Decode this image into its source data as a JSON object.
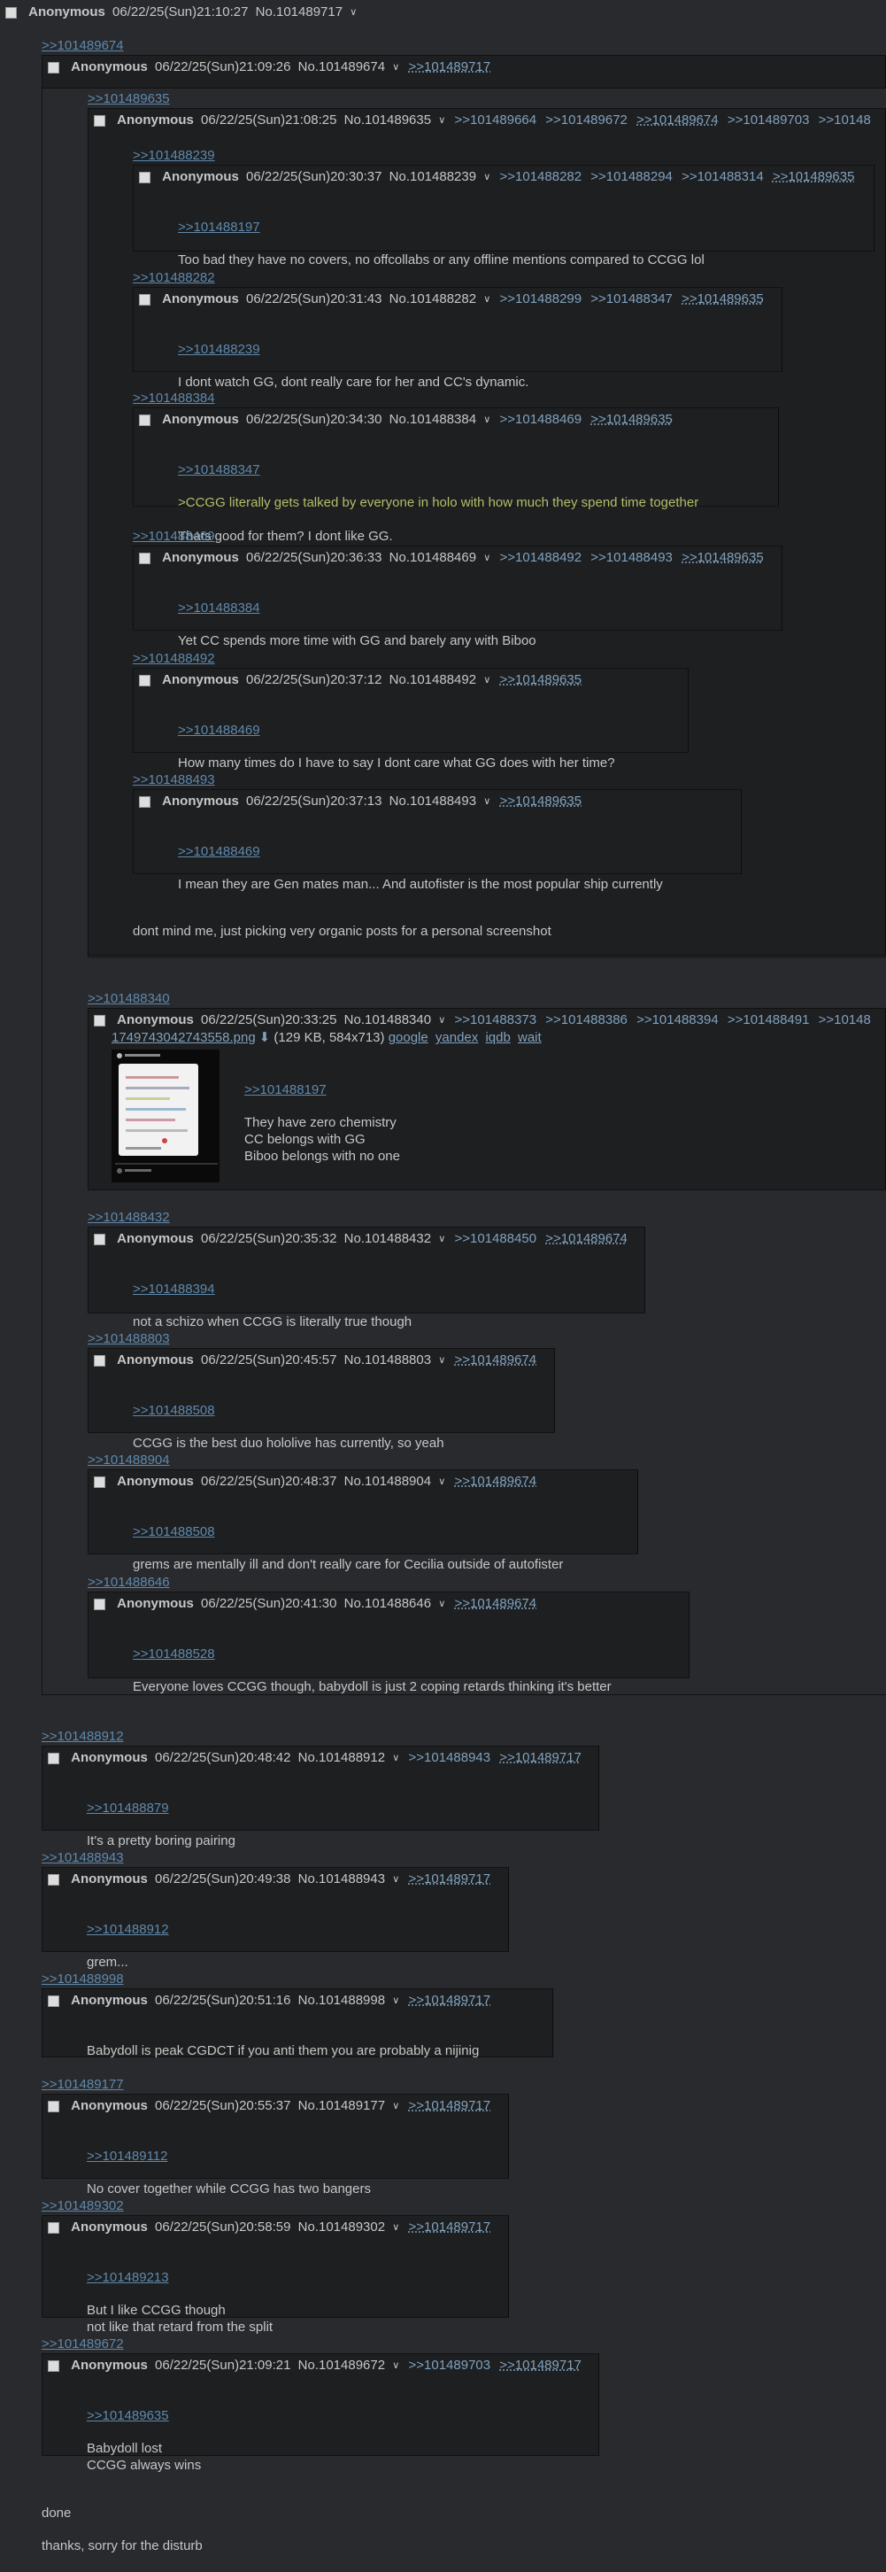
{
  "op": {
    "name": "Anonymous",
    "datetime": "06/22/25(Sun)21:10:27",
    "number": "No.101489717"
  },
  "posts": [
    {
      "id": "p1",
      "quote_header": ">>101489674",
      "name": "Anonymous",
      "datetime": "06/22/25(Sun)21:09:26",
      "number": "No.101489674",
      "backlinks": [
        ">>101489717"
      ]
    },
    {
      "id": "p2",
      "quote_header": ">>101489635",
      "name": "Anonymous",
      "datetime": "06/22/25(Sun)21:08:25",
      "number": "No.101489635",
      "backlinks": [
        ">>101489664",
        ">>101489672",
        ">>101489674",
        ">>101489703",
        ">>10148"
      ]
    },
    {
      "id": "p3",
      "quote_header": ">>101488239",
      "name": "Anonymous",
      "datetime": "06/22/25(Sun)20:30:37",
      "number": "No.101488239",
      "backlinks": [
        ">>101488282",
        ">>101488294",
        ">>101488314",
        ">>101489635"
      ],
      "quote": ">>101488197",
      "lines": [
        "Too bad they have no covers, no offcollabs or any offline mentions compared to CCGG lol"
      ]
    },
    {
      "id": "p4",
      "quote_header": ">>101488282",
      "name": "Anonymous",
      "datetime": "06/22/25(Sun)20:31:43",
      "number": "No.101488282",
      "backlinks": [
        ">>101488299",
        ">>101488347",
        ">>101489635"
      ],
      "quote": ">>101488239",
      "lines": [
        "I dont watch GG, dont really care for her and CC's dynamic."
      ]
    },
    {
      "id": "p5",
      "quote_header": ">>101488384",
      "name": "Anonymous",
      "datetime": "06/22/25(Sun)20:34:30",
      "number": "No.101488384",
      "backlinks": [
        ">>101488469",
        ">>101489635"
      ],
      "quote": ">>101488347",
      "greentext": ">CCGG literally gets talked by everyone in holo with how much they spend time together",
      "lines": [
        "Thats good for them? I dont like GG."
      ]
    },
    {
      "id": "p6",
      "quote_header": ">>101488469",
      "name": "Anonymous",
      "datetime": "06/22/25(Sun)20:36:33",
      "number": "No.101488469",
      "backlinks": [
        ">>101488492",
        ">>101488493",
        ">>101489635"
      ],
      "quote": ">>101488384",
      "lines": [
        "Yet CC spends more time with GG and barely any with Biboo"
      ]
    },
    {
      "id": "p7",
      "quote_header": ">>101488492",
      "name": "Anonymous",
      "datetime": "06/22/25(Sun)20:37:12",
      "number": "No.101488492",
      "backlinks": [
        ">>101489635"
      ],
      "quote": ">>101488469",
      "lines": [
        "How many times do I have to say I dont care what GG does with her time?"
      ]
    },
    {
      "id": "p8",
      "quote_header": ">>101488493",
      "name": "Anonymous",
      "datetime": "06/22/25(Sun)20:37:13",
      "number": "No.101488493",
      "backlinks": [
        ">>101489635"
      ],
      "quote": ">>101488469",
      "lines": [
        "I mean they are Gen mates man... And autofister is the most popular ship currently"
      ]
    },
    {
      "id": "p9",
      "quote_header": ">>101488340",
      "name": "Anonymous",
      "datetime": "06/22/25(Sun)20:33:25",
      "number": "No.101488340",
      "backlinks": [
        ">>101488373",
        ">>101488386",
        ">>101488394",
        ">>101488491",
        ">>10148"
      ],
      "file": {
        "name": "1749743042743558.png",
        "meta": "(129 KB, 584x713)",
        "links": [
          "google",
          "yandex",
          "iqdb",
          "wait"
        ]
      },
      "quote": ">>101488197",
      "lines": [
        "They have zero chemistry",
        "CC belongs with GG",
        "Biboo belongs with no one"
      ]
    },
    {
      "id": "p10",
      "quote_header": ">>101488432",
      "name": "Anonymous",
      "datetime": "06/22/25(Sun)20:35:32",
      "number": "No.101488432",
      "backlinks": [
        ">>101488450",
        ">>101489674"
      ],
      "quote": ">>101488394",
      "lines": [
        "not a schizo when CCGG is literally true though"
      ]
    },
    {
      "id": "p11",
      "quote_header": ">>101488803",
      "name": "Anonymous",
      "datetime": "06/22/25(Sun)20:45:57",
      "number": "No.101488803",
      "backlinks": [
        ">>101489674"
      ],
      "quote": ">>101488508",
      "lines": [
        "CCGG is the best duo hololive has currently, so yeah"
      ]
    },
    {
      "id": "p12",
      "quote_header": ">>101488904",
      "name": "Anonymous",
      "datetime": "06/22/25(Sun)20:48:37",
      "number": "No.101488904",
      "backlinks": [
        ">>101489674"
      ],
      "quote": ">>101488508",
      "lines": [
        "grems are mentally ill and don't really care for Cecilia outside of autofister"
      ]
    },
    {
      "id": "p13",
      "quote_header": ">>101488646",
      "name": "Anonymous",
      "datetime": "06/22/25(Sun)20:41:30",
      "number": "No.101488646",
      "backlinks": [
        ">>101489674"
      ],
      "quote": ">>101488528",
      "lines": [
        "Everyone loves CCGG though, babydoll is just 2 coping retards thinking it's better"
      ]
    },
    {
      "id": "p14",
      "quote_header": ">>101488912",
      "name": "Anonymous",
      "datetime": "06/22/25(Sun)20:48:42",
      "number": "No.101488912",
      "backlinks": [
        ">>101488943",
        ">>101489717"
      ],
      "quote": ">>101488879",
      "lines": [
        "It's a pretty boring pairing"
      ]
    },
    {
      "id": "p15",
      "quote_header": ">>101488943",
      "name": "Anonymous",
      "datetime": "06/22/25(Sun)20:49:38",
      "number": "No.101488943",
      "backlinks": [
        ">>101489717"
      ],
      "quote": ">>101488912",
      "lines": [
        "grem..."
      ]
    },
    {
      "id": "p16",
      "quote_header": ">>101488998",
      "name": "Anonymous",
      "datetime": "06/22/25(Sun)20:51:16",
      "number": "No.101488998",
      "backlinks": [
        ">>101489717"
      ],
      "lines": [
        "Babydoll is peak CGDCT if you anti them you are probably a nijinig"
      ]
    },
    {
      "id": "p17",
      "quote_header": ">>101489177",
      "name": "Anonymous",
      "datetime": "06/22/25(Sun)20:55:37",
      "number": "No.101489177",
      "backlinks": [
        ">>101489717"
      ],
      "quote": ">>101489112",
      "lines": [
        "No cover together while CCGG has two bangers"
      ]
    },
    {
      "id": "p18",
      "quote_header": ">>101489302",
      "name": "Anonymous",
      "datetime": "06/22/25(Sun)20:58:59",
      "number": "No.101489302",
      "backlinks": [
        ">>101489717"
      ],
      "quote": ">>101489213",
      "lines": [
        "But I like CCGG though",
        "not like that retard from the split"
      ]
    },
    {
      "id": "p19",
      "quote_header": ">>101489672",
      "name": "Anonymous",
      "datetime": "06/22/25(Sun)21:09:21",
      "number": "No.101489672",
      "backlinks": [
        ">>101489703",
        ">>101489717"
      ],
      "quote": ">>101489635",
      "lines": [
        "Babydoll lost",
        "CCGG always wins"
      ]
    }
  ],
  "messages": {
    "p2_footer": "dont mind me, just picking very organic posts for a personal screenshot",
    "op_footer": [
      "done",
      "thanks, sorry for the disturb"
    ]
  },
  "icons": {
    "checkbox": "checkbox-icon",
    "menu": "chevron-down-icon",
    "file": "download-icon"
  },
  "colors": {
    "background": "#282a2e",
    "post": "#1d1f21",
    "text": "#c5c8c6",
    "link": "#81a2be",
    "quote": "#5f89ac",
    "greentext": "#b5bd68"
  }
}
